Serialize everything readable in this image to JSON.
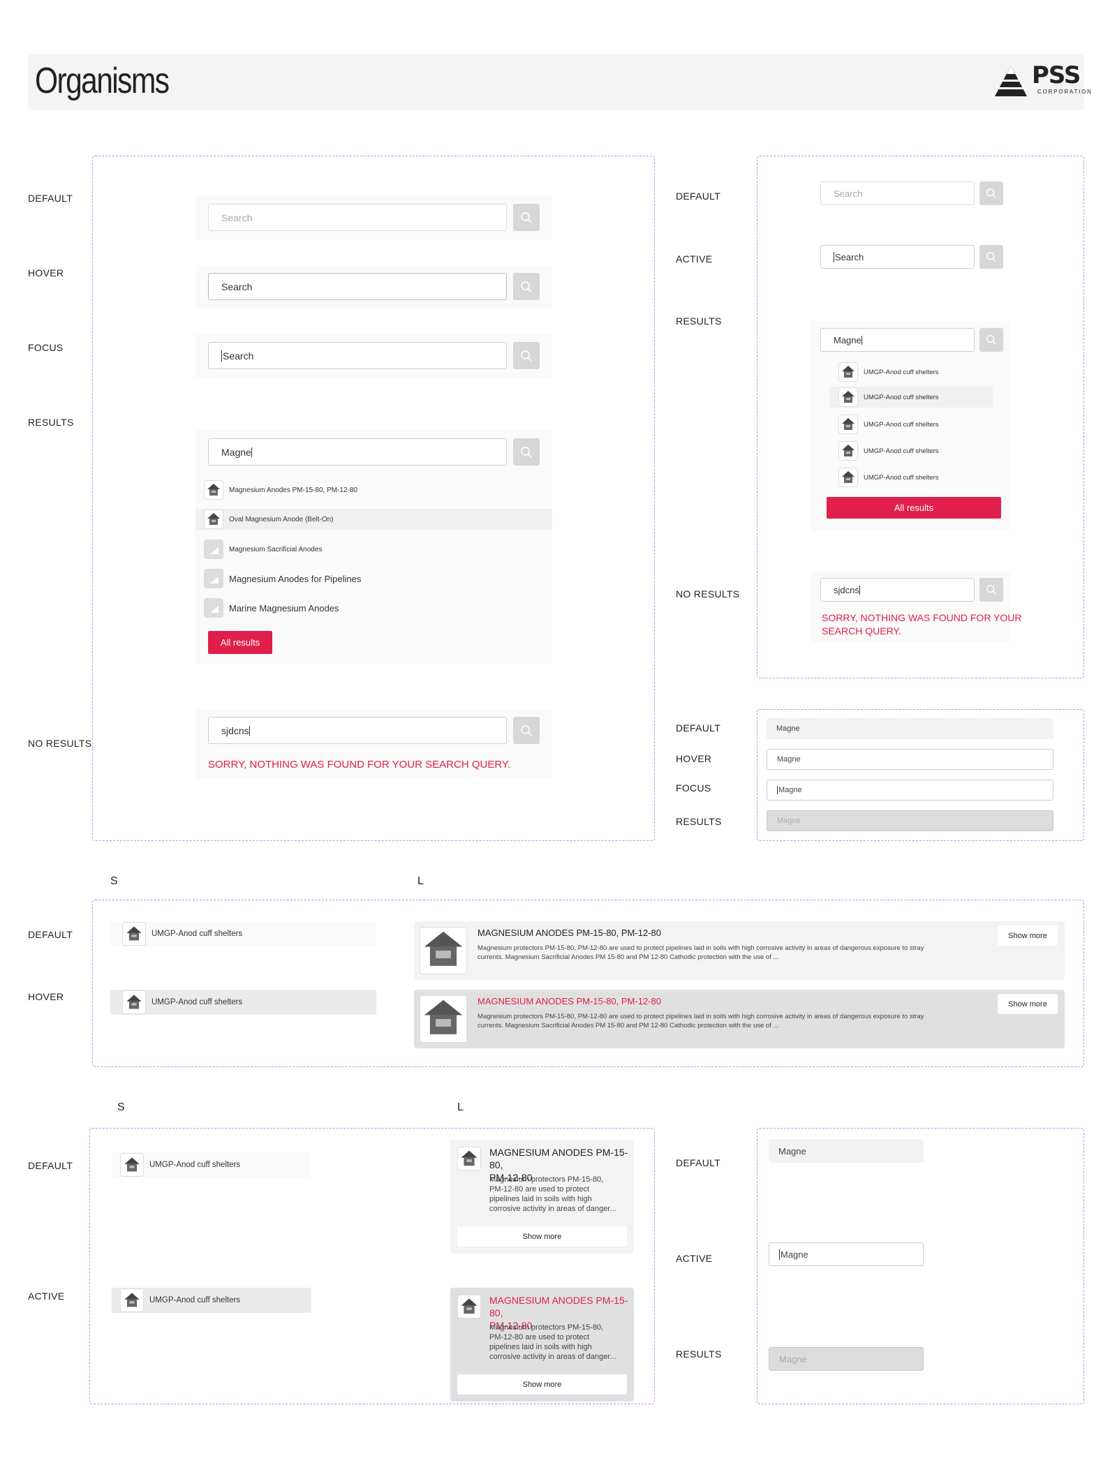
{
  "page": {
    "title": "Organisms",
    "logo_text": "PSS",
    "logo_sub": "CORPORATION"
  },
  "colors": {
    "accent": "#e0204a",
    "frame": "#c58ae6",
    "panel": "#fafafa",
    "button_grey": "#d7d7d7"
  },
  "search_l": {
    "states": [
      "DEFAULT",
      "HOVER",
      "FOCUS",
      "RESULTS",
      "NO RESULTS"
    ],
    "placeholder": "Search",
    "hover_value": "Search",
    "focus_value": "Search",
    "results_query": "Magne",
    "results": [
      "Magnesium Anodes PM-15-80, PM-12-80",
      "Oval Magnesium Anode (Belt-On)",
      "Magnesium Sacrificial Anodes",
      "Magnesium Anodes for Pipelines",
      "Marine Magnesium Anodes"
    ],
    "all_results": "All results",
    "no_results_query": "sjdcns",
    "no_results_msg": "SORRY, NOTHING WAS FOUND FOR YOUR SEARCH QUERY."
  },
  "search_s": {
    "states": [
      "DEFAULT",
      "ACTIVE",
      "RESULTS",
      "NO RESULTS"
    ],
    "placeholder": "Search",
    "active_value": "Search",
    "results_query": "Magne",
    "results": [
      "UMGP-Anod cuff shelters",
      "UMGP-Anod cuff shelters",
      "UMGP-Anod cuff shelters",
      "UMGP-Anod cuff shelters",
      "UMGP-Anod cuff shelters"
    ],
    "all_results": "All results",
    "no_results_query": "sjdcns",
    "no_results_msg_1": "SORRY, NOTHING WAS FOUND FOR YOUR",
    "no_results_msg_2": "SEARCH QUERY."
  },
  "input_states": {
    "states": [
      "DEFAULT",
      "HOVER",
      "FOCUS",
      "RESULTS"
    ],
    "value": "Magne"
  },
  "cards_wide": {
    "size_s": "S",
    "size_l": "L",
    "states": [
      "DEFAULT",
      "HOVER"
    ],
    "small_label": "UMGP-Anod cuff shelters",
    "title": "MAGNESIUM ANODES PM-15-80, PM-12-80",
    "desc_1": "Magnesium protectors PM-15-80, PM-12-80 are used to protect pipelines laid in soils with high corrosive activity in areas of dangerous exposure to stray",
    "desc_2": "currents. Magnesium Sacrificial Anodes PM 15-80 and PM 12-80 Cathodic protection with the use of ...",
    "show_more": "Show more"
  },
  "cards_mobile": {
    "size_s": "S",
    "size_l": "L",
    "states": [
      "DEFAULT",
      "ACTIVE"
    ],
    "small_label": "UMGP-Anod cuff shelters",
    "title_1": "MAGNESIUM ANODES PM-15-80,",
    "title_2": "PM-12-80",
    "desc": [
      "Magnesium protectors PM-15-80,",
      "PM-12-80 are used to protect",
      "pipelines laid in soils with high",
      "corrosive activity in areas of danger..."
    ],
    "show_more": "Show more"
  },
  "input_mobile": {
    "states": [
      "DEFAULT",
      "ACTIVE",
      "RESULTS"
    ],
    "value": "Magne"
  }
}
